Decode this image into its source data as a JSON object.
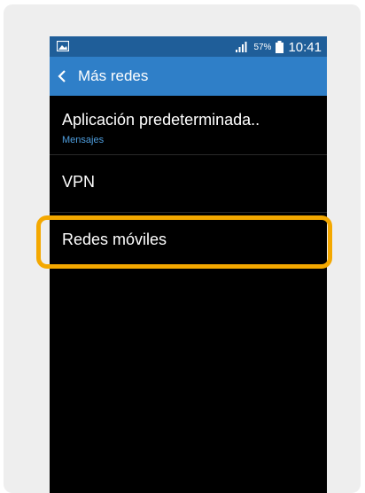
{
  "status_bar": {
    "battery_percent": "57%",
    "time": "10:41",
    "left_icon": "image-icon",
    "signal_icon": "signal-icon",
    "battery_icon": "battery-icon"
  },
  "action_bar": {
    "title": "Más redes",
    "back_icon": "chevron-left-icon"
  },
  "items": [
    {
      "title": "Aplicación predeterminada..",
      "subtitle": "Mensajes"
    },
    {
      "title": "VPN"
    },
    {
      "title": "Redes móviles"
    }
  ],
  "colors": {
    "status_bar": "#1f5e99",
    "action_bar": "#2f7fc8",
    "highlight": "#f4a800",
    "subtitle": "#4f9fe0"
  }
}
